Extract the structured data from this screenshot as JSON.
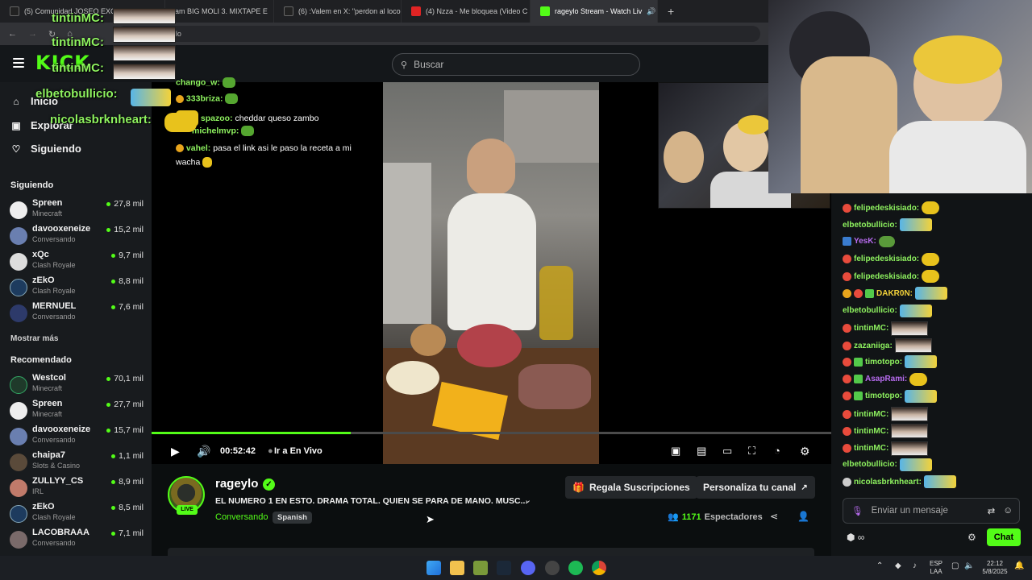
{
  "browser": {
    "tabs": [
      {
        "label": "(5) Comunidad JOSEO EXC",
        "color": "#222"
      },
      {
        "label": "am BIG MOLI 3. MIXTAPE E",
        "color": "#222"
      },
      {
        "label": "(6) :Valem en X: \"perdon al loco",
        "color": "#222"
      },
      {
        "label": "(4) Nzza - Me bloquea (Video C",
        "color": "#e02424"
      },
      {
        "label": "rageylo Stream - Watch Liv",
        "color": "#53fc18"
      }
    ],
    "new_tab": "+",
    "address": "kick.com/rageylo"
  },
  "header": {
    "logo": "KICK",
    "search_placeholder": "Buscar"
  },
  "sidebar": {
    "nav": [
      {
        "label": "Inicio",
        "icon": "home-icon"
      },
      {
        "label": "Explorar",
        "icon": "compass-icon"
      },
      {
        "label": "Siguiendo",
        "icon": "heart-icon"
      }
    ],
    "following_title": "Siguiendo",
    "following": [
      {
        "name": "Spreen",
        "category": "Minecraft",
        "viewers": "27,8 mil"
      },
      {
        "name": "davooxeneize",
        "category": "Conversando",
        "viewers": "15,2 mil"
      },
      {
        "name": "xQc",
        "category": "Clash Royale",
        "viewers": "9,7 mil"
      },
      {
        "name": "zEkO",
        "category": "Clash Royale",
        "viewers": "8,8 mil"
      },
      {
        "name": "MERNUEL",
        "category": "Conversando",
        "viewers": "7,6 mil"
      }
    ],
    "show_more": "Mostrar más",
    "recommended_title": "Recomendado",
    "recommended": [
      {
        "name": "Westcol",
        "category": "Minecraft",
        "viewers": "70,1 mil"
      },
      {
        "name": "Spreen",
        "category": "Minecraft",
        "viewers": "27,7 mil"
      },
      {
        "name": "davooxeneize",
        "category": "Conversando",
        "viewers": "15,7 mil"
      },
      {
        "name": "chaipa7",
        "category": "Slots & Casino",
        "viewers": "1,1 mil"
      },
      {
        "name": "ZULLYY_CS",
        "category": "IRL",
        "viewers": "8,9 mil"
      },
      {
        "name": "zEkO",
        "category": "Clash Royale",
        "viewers": "8,5 mil"
      },
      {
        "name": "LACOBRAAA",
        "category": "Conversando",
        "viewers": "7,1 mil"
      }
    ]
  },
  "overlay_top_left": [
    {
      "name": "tintinMC:"
    },
    {
      "name": "tintinMC:"
    },
    {
      "name": "tintinMC:"
    },
    {
      "name": "elbetobullicio:"
    },
    {
      "name": "nicolasbrknheart:"
    }
  ],
  "video_chat_overlay": [
    {
      "user": "chango_w:",
      "text": ""
    },
    {
      "user": "333briza:",
      "text": ""
    },
    {
      "user": "spazoo:",
      "text": "cheddar queso zambo"
    },
    {
      "user": "michelmvp:",
      "text": ""
    },
    {
      "user": "vahel:",
      "text": "pasa el link asi le paso la receta a mi"
    },
    {
      "user": "",
      "text": "wacha"
    }
  ],
  "player": {
    "time": "00:52:42",
    "live_label": "Ir a En Vivo",
    "progress": 0.293
  },
  "stream": {
    "channel": "rageylo",
    "live_badge": "LIVE",
    "title": "EL NUMERO 1 EN ESTO. DRAMA TOTAL. QUIEN SE PARA DE MANO. MUSC...",
    "category": "Conversando",
    "language": "Spanish",
    "gift_button": "Regala Suscripciones",
    "customize_button": "Personaliza tu canal",
    "viewers_count": "1171",
    "viewers_label": "Espectadores"
  },
  "chat": {
    "messages": [
      {
        "user": "felipedeskisiado:",
        "color": "#8ef25f",
        "badges": [
          "r"
        ],
        "emote": "duck"
      },
      {
        "user": "elbetobullicio:",
        "color": "#8ef25f",
        "badges": [],
        "emote": "car"
      },
      {
        "user": "YesK:",
        "color": "#b86cf0",
        "badges": [
          "b"
        ],
        "emote": "frog"
      },
      {
        "user": "felipedeskisiado:",
        "color": "#8ef25f",
        "badges": [
          "r"
        ],
        "emote": "duck"
      },
      {
        "user": "felipedeskisiado:",
        "color": "#8ef25f",
        "badges": [
          "r"
        ],
        "emote": "duck"
      },
      {
        "user": "DAKR0N:",
        "color": "#f3d23a",
        "badges": [
          "o",
          "r",
          "g"
        ],
        "emote": "car"
      },
      {
        "user": "elbetobullicio:",
        "color": "#8ef25f",
        "badges": [],
        "emote": "car"
      },
      {
        "user": "tintinMC:",
        "color": "#8ef25f",
        "badges": [
          "r"
        ],
        "emote": "face"
      },
      {
        "user": "zazaniiga:",
        "color": "#8ef25f",
        "badges": [
          "r"
        ],
        "emote": "face"
      },
      {
        "user": "timotopo:",
        "color": "#8ef25f",
        "badges": [
          "r",
          "g"
        ],
        "emote": "car"
      },
      {
        "user": "AsapRami:",
        "color": "#b86cf0",
        "badges": [
          "r",
          "g"
        ],
        "emote": "duck"
      },
      {
        "user": "timotopo:",
        "color": "#8ef25f",
        "badges": [
          "r",
          "g"
        ],
        "emote": "car"
      },
      {
        "user": "tintinMC:",
        "color": "#8ef25f",
        "badges": [
          "r"
        ],
        "emote": "face"
      },
      {
        "user": "tintinMC:",
        "color": "#8ef25f",
        "badges": [
          "r"
        ],
        "emote": "face"
      },
      {
        "user": "tintinMC:",
        "color": "#8ef25f",
        "badges": [
          "r"
        ],
        "emote": "face"
      },
      {
        "user": "elbetobullicio:",
        "color": "#8ef25f",
        "badges": [],
        "emote": "car"
      },
      {
        "user": "nicolasbrknheart:",
        "color": "#8ef25f",
        "badges": [
          "w"
        ],
        "emote": "car"
      }
    ],
    "input_placeholder": "Enviar un mensaje",
    "send_button": "Chat"
  },
  "taskbar": {
    "lang_top": "ESP",
    "lang_bottom": "LAA",
    "time": "22:12",
    "date": "5/8/2025"
  },
  "colors": {
    "accent": "#53fc18",
    "background": "#0b0e0f"
  }
}
